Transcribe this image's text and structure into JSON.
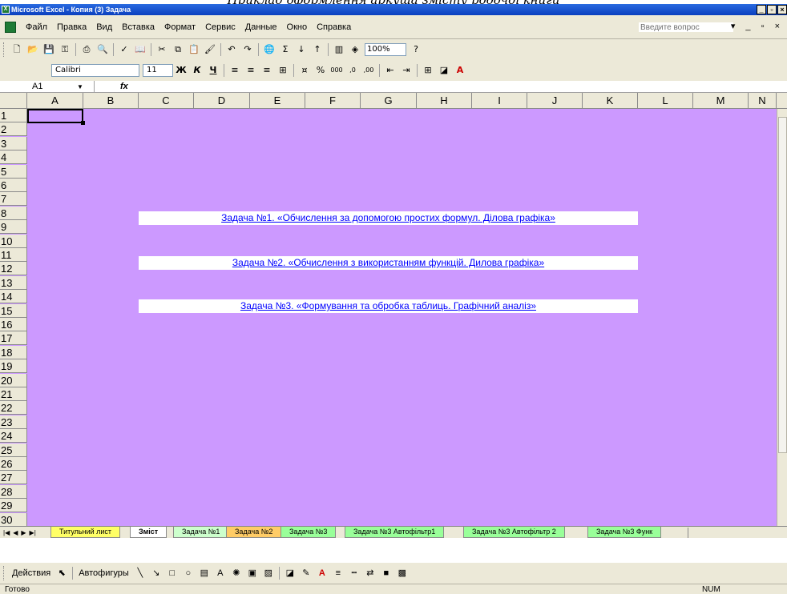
{
  "caption": "Приклад оформлення аркуша змісту робочої книги",
  "window": {
    "title": "Microsoft Excel - Копия (3) Задача",
    "buttons": [
      "_",
      "▫",
      "×"
    ]
  },
  "menu": {
    "items": [
      "Файл",
      "Правка",
      "Вид",
      "Вставка",
      "Формат",
      "Сервис",
      "Данные",
      "Окно",
      "Справка"
    ],
    "help_placeholder": "Введите вопрос"
  },
  "toolbar": {
    "zoom": "100%"
  },
  "format_toolbar": {
    "font": "Calibri",
    "size": "11"
  },
  "formula_bar": {
    "cell_ref": "A1",
    "fx": "fx"
  },
  "grid": {
    "columns": [
      "A",
      "B",
      "C",
      "D",
      "E",
      "F",
      "G",
      "H",
      "I",
      "J",
      "K",
      "L",
      "M",
      "N"
    ],
    "rows": [
      "1",
      "2",
      "3",
      "4",
      "5",
      "6",
      "7",
      "8",
      "9",
      "10",
      "11",
      "12",
      "13",
      "14",
      "15",
      "16",
      "17",
      "18",
      "19",
      "20",
      "21",
      "22",
      "23",
      "24",
      "25",
      "26",
      "27",
      "28",
      "29",
      "30"
    ],
    "bg_color": "#cc99ff",
    "links": [
      {
        "row": 8,
        "text": "Задача №1. «Обчислення за допомогою простих формул. Ділова графіка»"
      },
      {
        "row": 11,
        "text": "Задача №2. «Обчислення з використанням функцій. Дилова графіка»"
      },
      {
        "row": 14,
        "text": "Задача №3. «Формування та обробка таблиць. Графічний аналіз»"
      }
    ]
  },
  "sheet_tabs": [
    {
      "label": "Титульний лист",
      "color": "#ffff66"
    },
    {
      "label": "Зміст",
      "color": "#ffffff",
      "active": true
    },
    {
      "label": "Задача №1",
      "color": "#ccffcc"
    },
    {
      "label": "Задача №2",
      "color": "#ffcc66"
    },
    {
      "label": "Задача №3",
      "color": "#99ff99"
    },
    {
      "label": "Задача №3 Автофільтр1",
      "color": "#99ff99"
    },
    {
      "label": "Задача №3 Автофільтр 2",
      "color": "#99ff99"
    },
    {
      "label": "Задача №3 Функ",
      "color": "#99ff99"
    }
  ],
  "draw_toolbar": {
    "actions": "Действия",
    "autoshapes": "Автофигуры"
  },
  "status": {
    "ready": "Готово",
    "num": "NUM"
  }
}
